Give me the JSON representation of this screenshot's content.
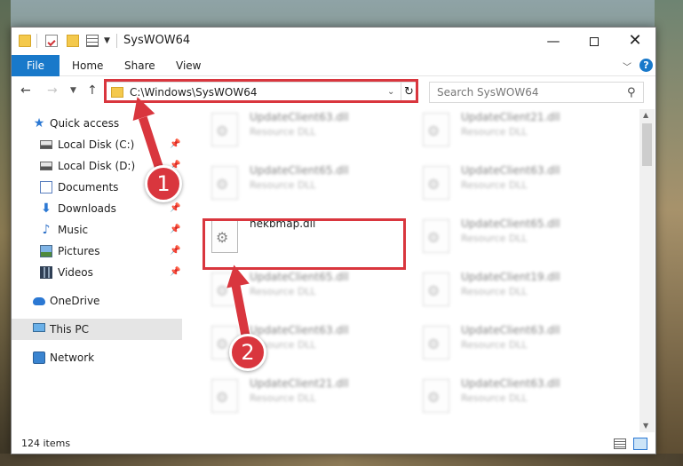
{
  "window": {
    "title": "SysWOW64"
  },
  "ribbon": {
    "tabs": [
      "File",
      "Home",
      "Share",
      "View"
    ],
    "help": "?"
  },
  "navigation": {
    "address_path": "C:\\Windows\\SysWOW64",
    "search_placeholder": "Search SysWOW64"
  },
  "sidebar": {
    "items": [
      {
        "label": "Quick access",
        "icon": "star-icon",
        "pinned": false
      },
      {
        "label": "Local Disk (C:)",
        "icon": "drive-icon",
        "pinned": true
      },
      {
        "label": "Local Disk (D:)",
        "icon": "drive-icon",
        "pinned": true
      },
      {
        "label": "Documents",
        "icon": "documents-icon",
        "pinned": true
      },
      {
        "label": "Downloads",
        "icon": "download-arrow-icon",
        "pinned": true
      },
      {
        "label": "Music",
        "icon": "music-note-icon",
        "pinned": true
      },
      {
        "label": "Pictures",
        "icon": "pictures-icon",
        "pinned": true
      },
      {
        "label": "Videos",
        "icon": "film-icon",
        "pinned": true
      },
      {
        "label": "OneDrive",
        "icon": "cloud-icon",
        "pinned": false
      },
      {
        "label": "This PC",
        "icon": "computer-icon",
        "pinned": false,
        "selected": true
      },
      {
        "label": "Network",
        "icon": "network-icon",
        "pinned": false
      }
    ]
  },
  "files": {
    "left_column": [
      {
        "name": "UpdateClient63.dll",
        "type": "Resource DLL",
        "blurred": true
      },
      {
        "name": "UpdateClient65.dll",
        "type": "Resource DLL",
        "blurred": true
      },
      {
        "name": "hekbmap.dll",
        "type": "",
        "blurred": false,
        "highlighted": true
      },
      {
        "name": "UpdateClient65.dll",
        "type": "Resource DLL",
        "blurred": true
      },
      {
        "name": "UpdateClient63.dll",
        "type": "Resource DLL",
        "blurred": true
      },
      {
        "name": "UpdateClient21.dll",
        "type": "Resource DLL",
        "blurred": true
      }
    ],
    "right_column": [
      {
        "name": "UpdateClient21.dll",
        "type": "Resource DLL",
        "blurred": true
      },
      {
        "name": "UpdateClient63.dll",
        "type": "Resource DLL",
        "blurred": true
      },
      {
        "name": "UpdateClient65.dll",
        "type": "Resource DLL",
        "blurred": true
      },
      {
        "name": "UpdateClient19.dll",
        "type": "Resource DLL",
        "blurred": true
      },
      {
        "name": "UpdateClient63.dll",
        "type": "Resource DLL",
        "blurred": true
      },
      {
        "name": "UpdateClient63.dll",
        "type": "Resource DLL",
        "blurred": true
      }
    ]
  },
  "status": {
    "item_count": "124 items"
  },
  "annotations": {
    "step1": "1",
    "step2": "2",
    "color": "#d9363e"
  },
  "colors": {
    "accent": "#1979ca",
    "selection": "#e5e5e5"
  }
}
